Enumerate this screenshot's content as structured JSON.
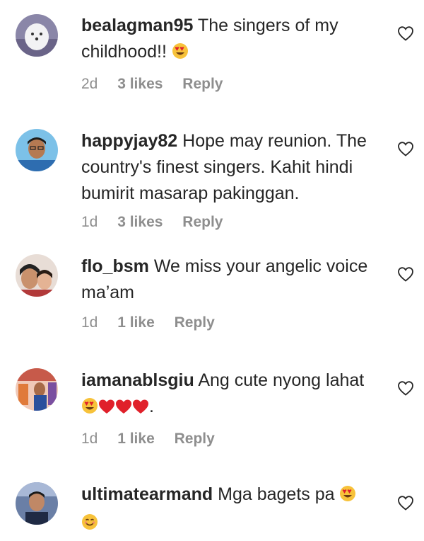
{
  "comments": [
    {
      "username": "bealagman95",
      "text": "The singers of my childhood!!",
      "emoji_after": [
        "smiling-heart-eyes"
      ],
      "time": "2d",
      "likes": "3 likes",
      "reply": "Reply"
    },
    {
      "username": "happyjay82",
      "text": "Hope may reunion. The country's finest singers. Kahit hindi bumirit masarap pakinggan.",
      "emoji_after": [],
      "time": "1d",
      "likes": "3 likes",
      "reply": "Reply"
    },
    {
      "username": "flo_bsm",
      "text": "We miss your angelic voice ma’am",
      "emoji_after": [],
      "time": "1d",
      "likes": "1 like",
      "reply": "Reply"
    },
    {
      "username": "iamanablsgiu",
      "text": "Ang cute nyong lahat",
      "emoji_after": [
        "smiling-heart-eyes",
        "red-heart",
        "red-heart",
        "red-heart"
      ],
      "text_after": ".",
      "time": "1d",
      "likes": "1 like",
      "reply": "Reply"
    },
    {
      "username": "ultimatearmand",
      "text": "Mga bagets pa",
      "emoji_after": [
        "smiling-heart-eyes",
        "smiling-face"
      ],
      "time": "",
      "likes": "",
      "reply": ""
    }
  ],
  "colors": {
    "text": "#262626",
    "meta": "#8e8e8e",
    "emoji_yellow": "#f7c23a",
    "heart_red": "#e0202a"
  }
}
